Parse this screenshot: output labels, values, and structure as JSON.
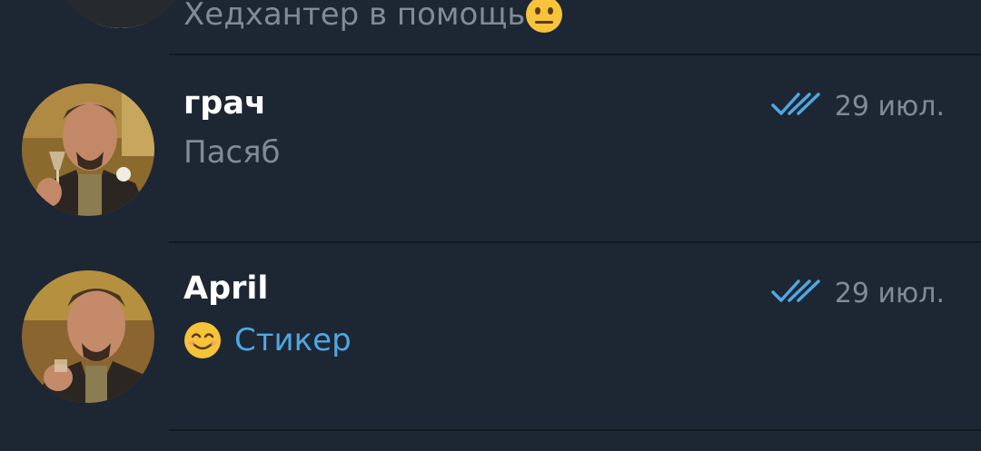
{
  "chats": [
    {
      "title": "",
      "preview": "Хедхантер в помощь",
      "preview_emoji": "neutral-face-emoji",
      "avatar": "man-portrait-avatar"
    },
    {
      "title": "грач",
      "preview": "Пасяб",
      "date": "29 июл.",
      "status": "double-check-read-icon",
      "avatar": "laughing-man-with-glass-avatar"
    },
    {
      "title": "April",
      "preview": "Стикер",
      "preview_emoji": "smiling-face-emoji",
      "date": "29 июл.",
      "status": "double-check-read-icon",
      "avatar": "laughing-man-with-glass-avatar"
    }
  ],
  "colors": {
    "background": "#1d2733",
    "title": "#ffffff",
    "secondary": "#7f8b97",
    "accent": "#4fa7e3",
    "divider": "#111820"
  }
}
